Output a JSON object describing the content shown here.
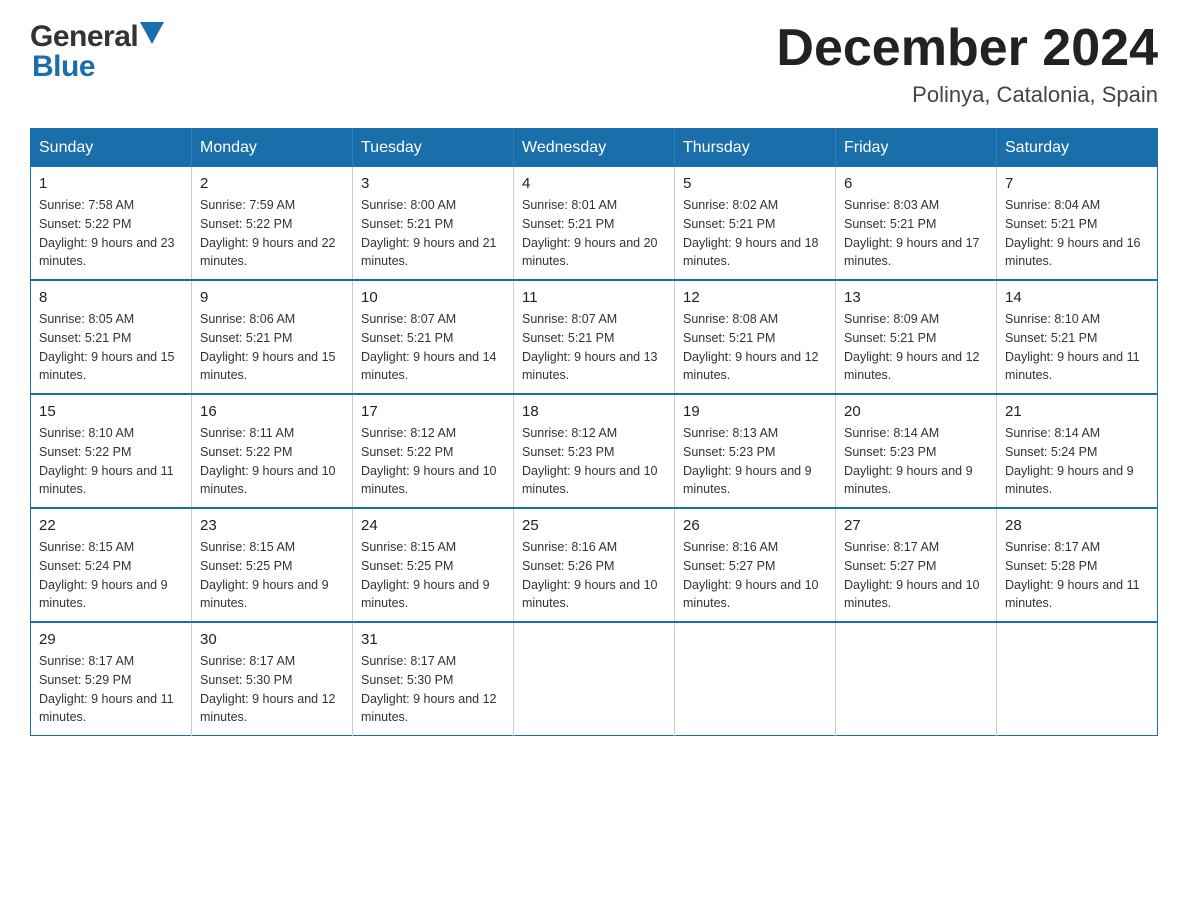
{
  "header": {
    "month_title": "December 2024",
    "location": "Polinya, Catalonia, Spain"
  },
  "days_of_week": [
    "Sunday",
    "Monday",
    "Tuesday",
    "Wednesday",
    "Thursday",
    "Friday",
    "Saturday"
  ],
  "weeks": [
    [
      {
        "day": "1",
        "sunrise": "7:58 AM",
        "sunset": "5:22 PM",
        "daylight": "9 hours and 23 minutes."
      },
      {
        "day": "2",
        "sunrise": "7:59 AM",
        "sunset": "5:22 PM",
        "daylight": "9 hours and 22 minutes."
      },
      {
        "day": "3",
        "sunrise": "8:00 AM",
        "sunset": "5:21 PM",
        "daylight": "9 hours and 21 minutes."
      },
      {
        "day": "4",
        "sunrise": "8:01 AM",
        "sunset": "5:21 PM",
        "daylight": "9 hours and 20 minutes."
      },
      {
        "day": "5",
        "sunrise": "8:02 AM",
        "sunset": "5:21 PM",
        "daylight": "9 hours and 18 minutes."
      },
      {
        "day": "6",
        "sunrise": "8:03 AM",
        "sunset": "5:21 PM",
        "daylight": "9 hours and 17 minutes."
      },
      {
        "day": "7",
        "sunrise": "8:04 AM",
        "sunset": "5:21 PM",
        "daylight": "9 hours and 16 minutes."
      }
    ],
    [
      {
        "day": "8",
        "sunrise": "8:05 AM",
        "sunset": "5:21 PM",
        "daylight": "9 hours and 15 minutes."
      },
      {
        "day": "9",
        "sunrise": "8:06 AM",
        "sunset": "5:21 PM",
        "daylight": "9 hours and 15 minutes."
      },
      {
        "day": "10",
        "sunrise": "8:07 AM",
        "sunset": "5:21 PM",
        "daylight": "9 hours and 14 minutes."
      },
      {
        "day": "11",
        "sunrise": "8:07 AM",
        "sunset": "5:21 PM",
        "daylight": "9 hours and 13 minutes."
      },
      {
        "day": "12",
        "sunrise": "8:08 AM",
        "sunset": "5:21 PM",
        "daylight": "9 hours and 12 minutes."
      },
      {
        "day": "13",
        "sunrise": "8:09 AM",
        "sunset": "5:21 PM",
        "daylight": "9 hours and 12 minutes."
      },
      {
        "day": "14",
        "sunrise": "8:10 AM",
        "sunset": "5:21 PM",
        "daylight": "9 hours and 11 minutes."
      }
    ],
    [
      {
        "day": "15",
        "sunrise": "8:10 AM",
        "sunset": "5:22 PM",
        "daylight": "9 hours and 11 minutes."
      },
      {
        "day": "16",
        "sunrise": "8:11 AM",
        "sunset": "5:22 PM",
        "daylight": "9 hours and 10 minutes."
      },
      {
        "day": "17",
        "sunrise": "8:12 AM",
        "sunset": "5:22 PM",
        "daylight": "9 hours and 10 minutes."
      },
      {
        "day": "18",
        "sunrise": "8:12 AM",
        "sunset": "5:23 PM",
        "daylight": "9 hours and 10 minutes."
      },
      {
        "day": "19",
        "sunrise": "8:13 AM",
        "sunset": "5:23 PM",
        "daylight": "9 hours and 9 minutes."
      },
      {
        "day": "20",
        "sunrise": "8:14 AM",
        "sunset": "5:23 PM",
        "daylight": "9 hours and 9 minutes."
      },
      {
        "day": "21",
        "sunrise": "8:14 AM",
        "sunset": "5:24 PM",
        "daylight": "9 hours and 9 minutes."
      }
    ],
    [
      {
        "day": "22",
        "sunrise": "8:15 AM",
        "sunset": "5:24 PM",
        "daylight": "9 hours and 9 minutes."
      },
      {
        "day": "23",
        "sunrise": "8:15 AM",
        "sunset": "5:25 PM",
        "daylight": "9 hours and 9 minutes."
      },
      {
        "day": "24",
        "sunrise": "8:15 AM",
        "sunset": "5:25 PM",
        "daylight": "9 hours and 9 minutes."
      },
      {
        "day": "25",
        "sunrise": "8:16 AM",
        "sunset": "5:26 PM",
        "daylight": "9 hours and 10 minutes."
      },
      {
        "day": "26",
        "sunrise": "8:16 AM",
        "sunset": "5:27 PM",
        "daylight": "9 hours and 10 minutes."
      },
      {
        "day": "27",
        "sunrise": "8:17 AM",
        "sunset": "5:27 PM",
        "daylight": "9 hours and 10 minutes."
      },
      {
        "day": "28",
        "sunrise": "8:17 AM",
        "sunset": "5:28 PM",
        "daylight": "9 hours and 11 minutes."
      }
    ],
    [
      {
        "day": "29",
        "sunrise": "8:17 AM",
        "sunset": "5:29 PM",
        "daylight": "9 hours and 11 minutes."
      },
      {
        "day": "30",
        "sunrise": "8:17 AM",
        "sunset": "5:30 PM",
        "daylight": "9 hours and 12 minutes."
      },
      {
        "day": "31",
        "sunrise": "8:17 AM",
        "sunset": "5:30 PM",
        "daylight": "9 hours and 12 minutes."
      },
      null,
      null,
      null,
      null
    ]
  ]
}
